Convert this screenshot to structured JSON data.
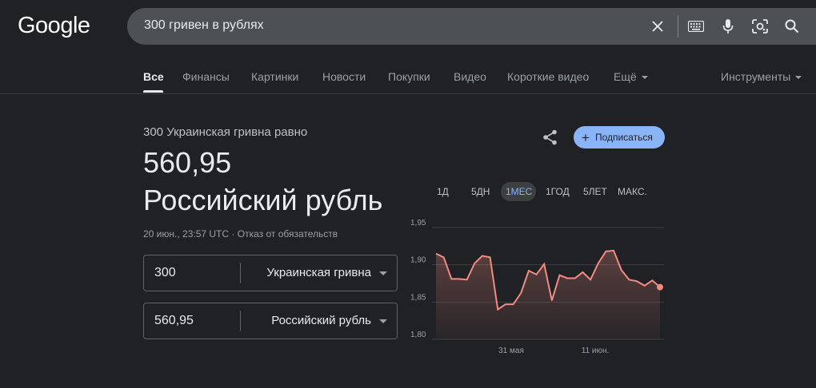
{
  "header": {
    "logo": "Google",
    "search_query": "300 гривен в рублях"
  },
  "tabs": {
    "items": [
      "Все",
      "Финансы",
      "Картинки",
      "Новости",
      "Покупки",
      "Видео",
      "Короткие видео",
      "Ещё"
    ],
    "tools": "Инструменты",
    "active": "Все"
  },
  "converter": {
    "equals_label": "300 Украинская гривна равно",
    "result_value": "560,95",
    "result_currency": "Российский рубль",
    "timestamp": "20 июн., 23:57 UTC",
    "disclaimer": "Отказ от обязательств",
    "from_amount": "300",
    "from_currency": "Украинская гривна",
    "to_amount": "560,95",
    "to_currency": "Российский рубль"
  },
  "actions": {
    "subscribe": "Подписаться"
  },
  "ranges": {
    "items": [
      "1Д",
      "5ДН",
      "1МЕС",
      "1ГОД",
      "5ЛЕТ",
      "МАКС."
    ],
    "active": "1МЕС"
  },
  "colors": {
    "background": "#202124",
    "accent": "#8ab4f8",
    "line": "#f28b82"
  },
  "chart_data": {
    "type": "area",
    "y_ticks": [
      "1,95",
      "1,90",
      "1,85",
      "1,80"
    ],
    "x_ticks": [
      "31 мая",
      "11 июн."
    ],
    "ylim": [
      1.8,
      1.95
    ],
    "x": [
      0,
      1,
      2,
      3,
      4,
      5,
      6,
      7,
      8,
      9,
      10,
      11,
      12,
      13,
      14,
      15,
      16,
      17,
      18,
      19,
      20,
      21,
      22,
      23,
      24,
      25,
      26,
      27,
      28
    ],
    "values": [
      1.915,
      1.91,
      1.881,
      1.881,
      1.88,
      1.902,
      1.912,
      1.91,
      1.84,
      1.847,
      1.847,
      1.862,
      1.892,
      1.887,
      1.901,
      1.852,
      1.886,
      1.882,
      1.882,
      1.89,
      1.88,
      1.902,
      1.918,
      1.919,
      1.893,
      1.88,
      1.878,
      1.872,
      1.879,
      1.87
    ]
  }
}
